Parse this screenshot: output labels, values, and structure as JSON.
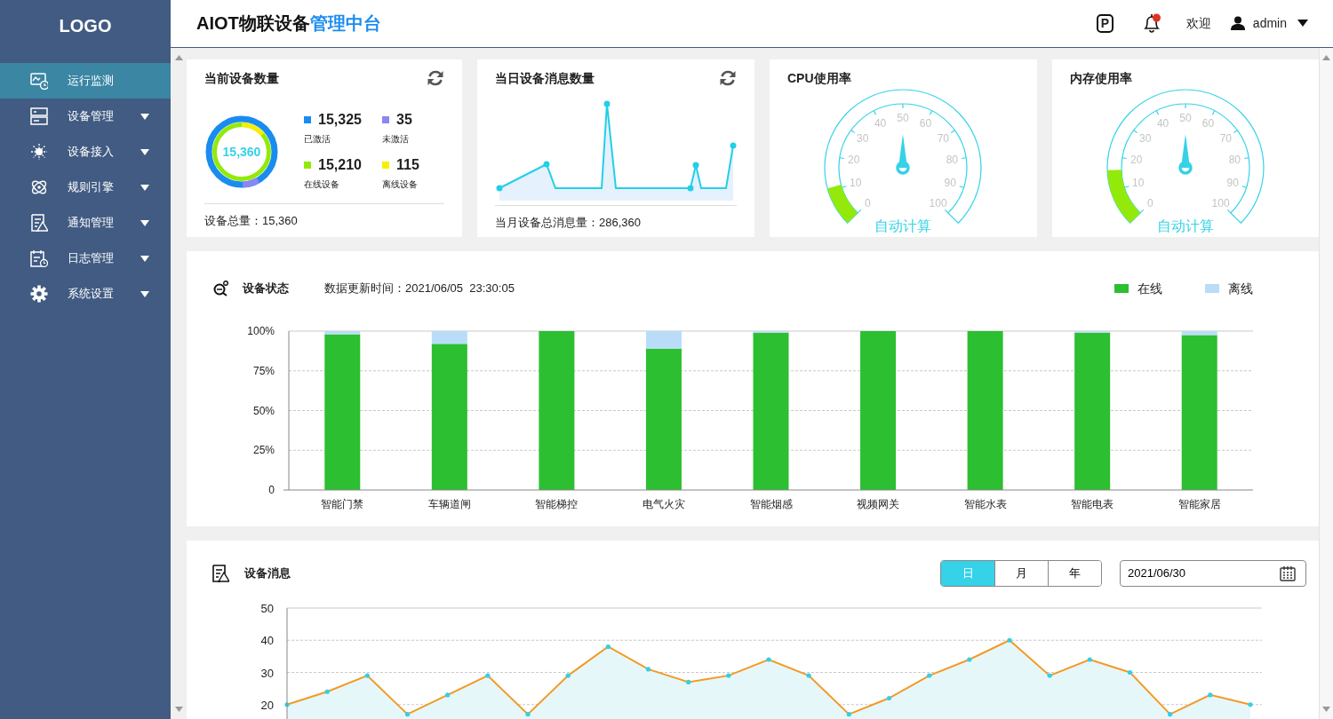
{
  "sidebar": {
    "logo": "LOGO",
    "items": [
      {
        "label": "运行监测",
        "selected": true,
        "submenu": false
      },
      {
        "label": "设备管理",
        "selected": false,
        "submenu": true
      },
      {
        "label": "设备接入",
        "selected": false,
        "submenu": true
      },
      {
        "label": "规则引擎",
        "selected": false,
        "submenu": true
      },
      {
        "label": "通知管理",
        "selected": false,
        "submenu": true
      },
      {
        "label": "日志管理",
        "selected": false,
        "submenu": true
      },
      {
        "label": "系统设置",
        "selected": false,
        "submenu": true
      }
    ]
  },
  "header": {
    "title": "AIOT物联设备",
    "title_highlight": "管理中台",
    "p_label": "P",
    "welcome": "欢迎",
    "user": "admin"
  },
  "summary_cards": [
    {
      "kind": "donut",
      "title": "当前设备数量",
      "refresh": true,
      "total": "15,360",
      "stats": [
        {
          "value": "15,325",
          "label": "已激活",
          "color": "#1a8cf0"
        },
        {
          "value": "35",
          "label": "未激活",
          "color": "#8a86f5"
        },
        {
          "value": "15,210",
          "label": "在线设备",
          "color": "#93ea0a"
        },
        {
          "value": "115",
          "label": "离线设备",
          "color": "#f7ef00"
        }
      ],
      "footer": "设备总量：15,360"
    },
    {
      "kind": "sparkline",
      "title": "当日设备消息数量",
      "refresh": true,
      "footer": "当月设备总消息量：286,360"
    },
    {
      "kind": "gauge",
      "title": "CPU使用率",
      "refresh": false,
      "scale": [
        "0",
        "10",
        "20",
        "30",
        "40",
        "50",
        "60",
        "70",
        "80",
        "90",
        "100"
      ],
      "level": 0.11,
      "caption": "自动计算"
    },
    {
      "kind": "gauge",
      "title": "内存使用率",
      "refresh": false,
      "scale": [
        "0",
        "10",
        "20",
        "30",
        "40",
        "50",
        "60",
        "70",
        "80",
        "90",
        "100"
      ],
      "level": 0.16,
      "caption": "自动计算"
    }
  ],
  "status_section": {
    "title": "设备状态",
    "updated": "数据更新时间：2021/06/05  23:30:05",
    "chart_data": {
      "type": "bar",
      "stacked": true,
      "categories": [
        "智能门禁",
        "车辆道闸",
        "智能梯控",
        "电气火灾",
        "智能烟感",
        "视频网关",
        "智能水表",
        "智能电表",
        "智能家居"
      ],
      "series": [
        {
          "name": "在线",
          "color": "#2cbf31",
          "values": [
            98,
            92,
            100,
            89,
            99,
            100,
            100,
            99,
            97.5
          ]
        },
        {
          "name": "离线",
          "color": "#b9ddf8",
          "values": [
            2,
            8,
            0,
            11,
            1,
            0,
            0,
            1,
            2.5
          ]
        }
      ],
      "ylim": [
        0,
        100
      ],
      "grid": true,
      "yticks": [
        {
          "value": 0,
          "label": "0"
        },
        {
          "value": 25,
          "label": "25%"
        },
        {
          "value": 50,
          "label": "50%"
        },
        {
          "value": 75,
          "label": "75%"
        },
        {
          "value": 100,
          "label": "100%"
        }
      ]
    }
  },
  "message_section": {
    "title": "设备消息",
    "ranges": [
      {
        "label": "日",
        "selected": true
      },
      {
        "label": "月",
        "selected": false
      },
      {
        "label": "年",
        "selected": false
      }
    ],
    "date": "2021/06/30",
    "chart_data": {
      "type": "area",
      "grid": true,
      "series": [
        {
          "color": "#f39a25",
          "values": [
            20,
            24,
            29,
            17,
            23,
            29,
            17,
            29,
            38,
            31,
            27,
            29,
            34,
            29,
            17,
            22,
            29,
            34,
            40,
            29,
            34,
            30,
            17,
            23,
            20
          ]
        }
      ],
      "ylim": [
        10,
        50
      ],
      "yticks": [
        20,
        30,
        40,
        50
      ]
    }
  }
}
